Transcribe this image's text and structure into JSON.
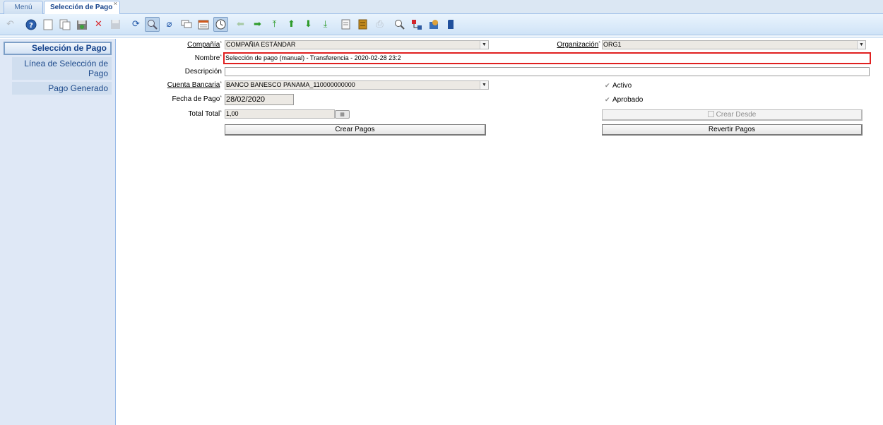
{
  "tabs": [
    {
      "label": "Menú (1)"
    },
    {
      "label": "Selección de Pago",
      "close": "×"
    }
  ],
  "toolbar": {
    "icons": [
      "undo-icon",
      "help-icon",
      "new-record-icon",
      "copy-record-icon",
      "save-new-icon",
      "delete-icon",
      "save-icon",
      "refresh-icon",
      "find-icon",
      "attachment-icon",
      "chat-icon",
      "grid-toggle-icon",
      "history-icon",
      "previous-icon",
      "next-icon",
      "first-record-icon",
      "parent-record-icon",
      "detail-record-icon",
      "last-record-icon",
      "report-icon",
      "archive-icon",
      "print-icon",
      "zoom-across-icon",
      "workflow-icon",
      "product-info-icon",
      "end-icon"
    ]
  },
  "nav": {
    "primary": "Selección de Pago",
    "items": [
      "Línea de Selección de Pago",
      "Pago Generado"
    ]
  },
  "form": {
    "company_label": "Compañía",
    "company_value": "COMPAÑIA ESTÁNDAR",
    "org_label": "Organización",
    "org_value": "ORG1",
    "name_label": "Nombre",
    "name_value": "Selección de pago (manual) - Transferencia - 2020-02-28 23:2",
    "desc_label": "Descripción",
    "desc_value": "",
    "bank_label": "Cuenta Bancaria",
    "bank_value": "BANCO BANESCO PANAMA_110000000000",
    "date_label": "Fecha de Pago",
    "date_value": "28/02/2020",
    "total_label": "Total Total",
    "total_value": "1,00",
    "active_label": "Activo",
    "approved_label": "Aprobado",
    "create_from_label": "Crear Desde",
    "create_payments_label": "Crear Pagos",
    "revert_payments_label": "Revertir Pagos",
    "required_mark": "*",
    "checkmark": "✔",
    "dropdown_arrow": "▼"
  }
}
